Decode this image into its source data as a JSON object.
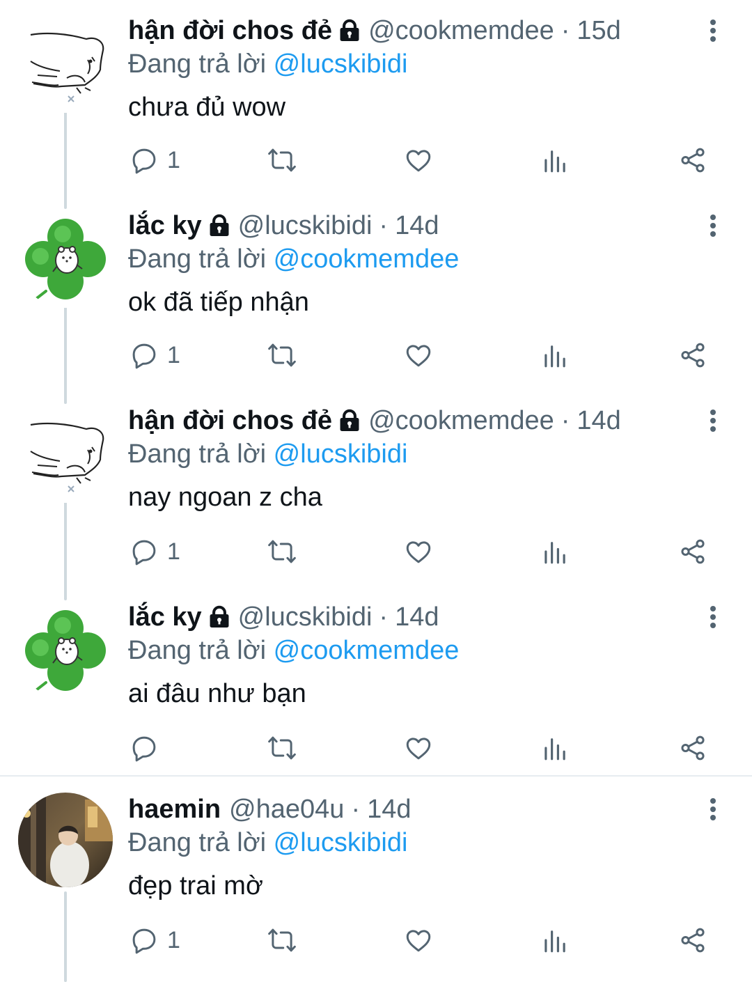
{
  "tweets": [
    {
      "display_name": "hận đời chos đẻ",
      "handle": "@cookmemdee",
      "separator": "·",
      "time": "15d",
      "replying_prefix": "Đang trả lời",
      "replying_to": "@lucskibidi",
      "text": "chưa đủ wow",
      "reply_count": "1",
      "avatar": "sketch-animal-avatar",
      "locked": true
    },
    {
      "display_name": "lắc ky",
      "handle": "@lucskibidi",
      "separator": "·",
      "time": "14d",
      "replying_prefix": "Đang trả lời",
      "replying_to": "@cookmemdee",
      "text": "ok đã tiếp nhận",
      "reply_count": "1",
      "avatar": "clover-bear-avatar",
      "locked": true
    },
    {
      "display_name": "hận đời chos đẻ",
      "handle": "@cookmemdee",
      "separator": "·",
      "time": "14d",
      "replying_prefix": "Đang trả lời",
      "replying_to": "@lucskibidi",
      "text": "nay ngoan z cha",
      "reply_count": "1",
      "avatar": "sketch-animal-avatar",
      "locked": true
    },
    {
      "display_name": "lắc ky",
      "handle": "@lucskibidi",
      "separator": "·",
      "time": "14d",
      "replying_prefix": "Đang trả lời",
      "replying_to": "@cookmemdee",
      "text": "ai đâu như bạn",
      "reply_count": "",
      "avatar": "clover-bear-avatar",
      "locked": true
    },
    {
      "display_name": "haemin",
      "handle": "@hae04u",
      "separator": "·",
      "time": "14d",
      "replying_prefix": "Đang trả lời",
      "replying_to": "@lucskibidi",
      "text": "đẹp trai mờ",
      "reply_count": "1",
      "avatar": "photo-avatar",
      "locked": false
    }
  ],
  "colors": {
    "text": "#0f1419",
    "secondary": "#536471",
    "mention": "#1d9bf0",
    "thread_line": "#cfd9de",
    "divider": "#e6ecf0"
  }
}
